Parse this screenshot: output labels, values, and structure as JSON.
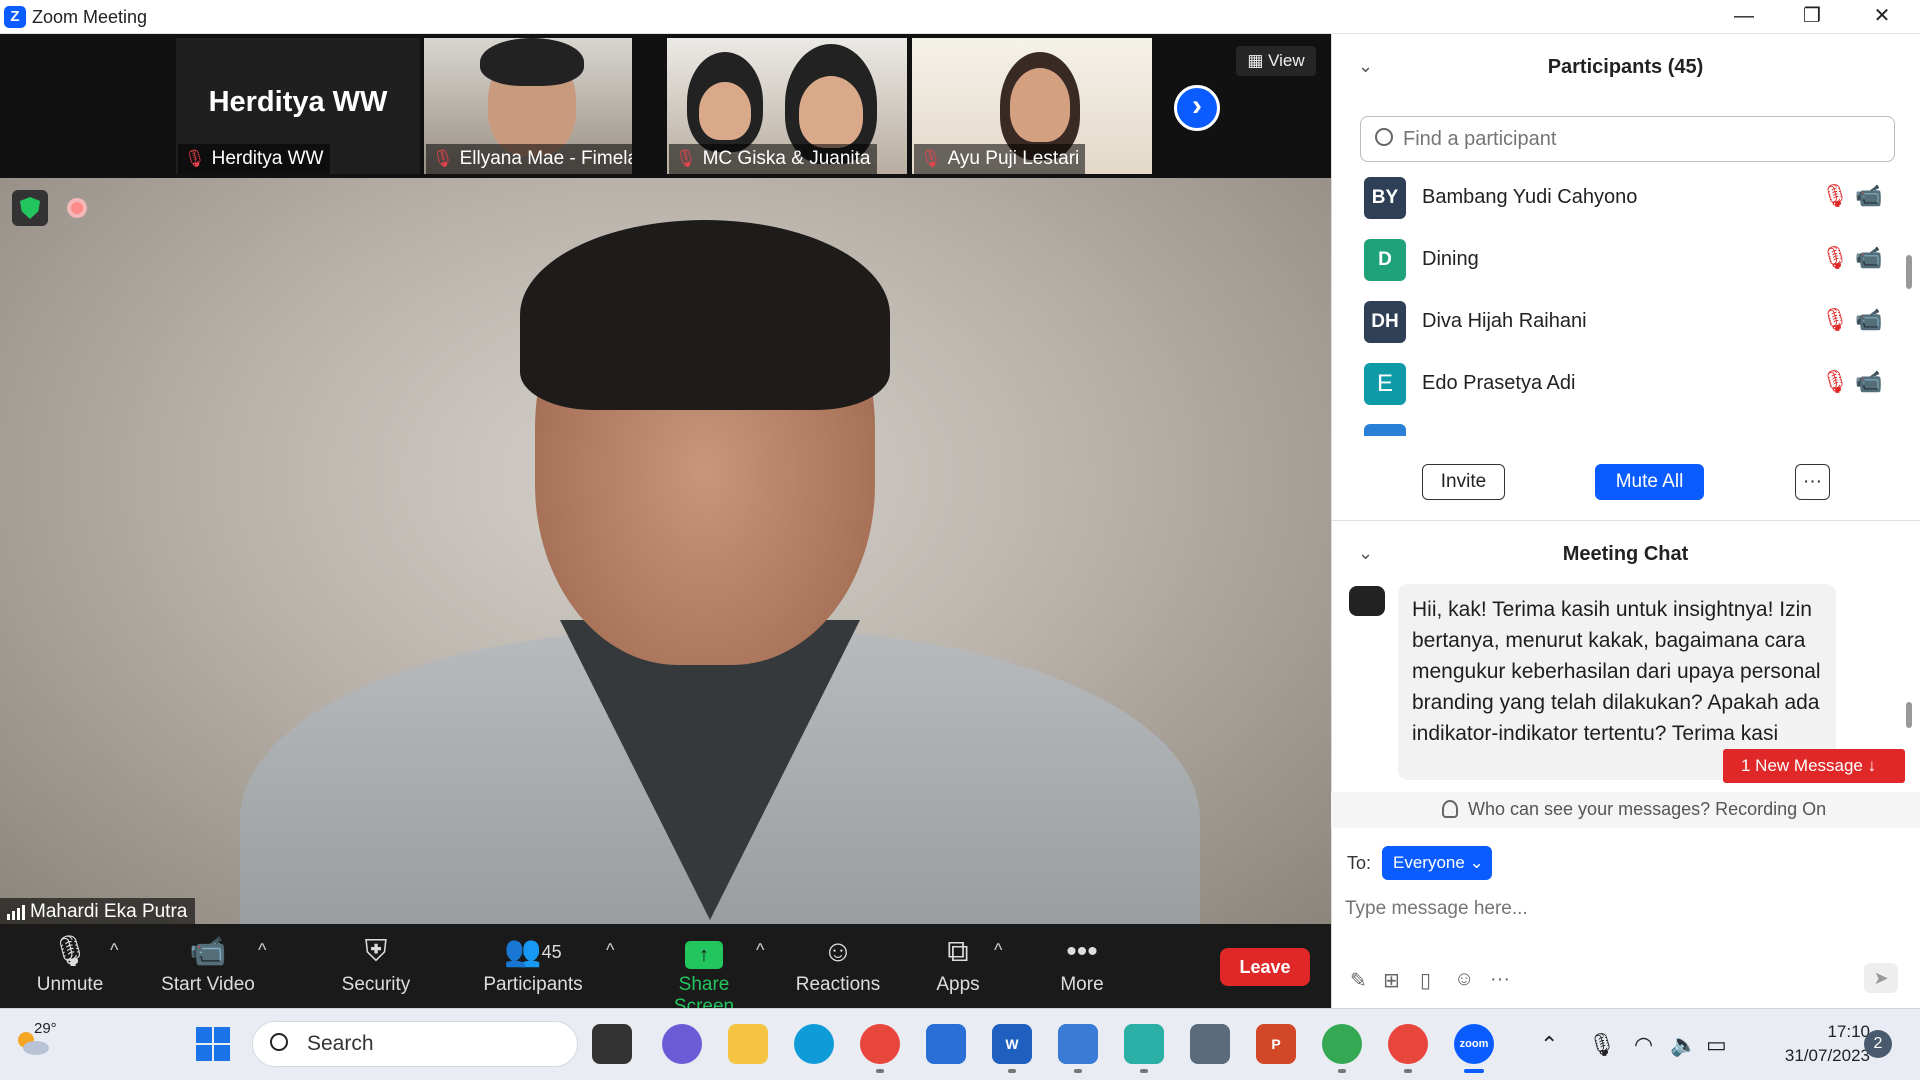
{
  "window": {
    "title": "Zoom Meeting",
    "minimize": "—",
    "restore": "❐",
    "close": "✕"
  },
  "thumbnails": [
    {
      "display_name": "Herditya WW",
      "label": "Herditya WW"
    },
    {
      "label": "Ellyana Mae - Fimela.c..."
    },
    {
      "label": "MC Giska & Juanita"
    },
    {
      "label": "Ayu Puji Lestari"
    }
  ],
  "view_button": "View",
  "next_page_glyph": "›",
  "active_speaker": {
    "name": "Mahardi Eka Putra"
  },
  "toolbar": {
    "unmute": "Unmute",
    "start_video": "Start Video",
    "security": "Security",
    "participants": "Participants",
    "participants_count": "45",
    "share_screen": "Share Screen",
    "reactions": "Reactions",
    "apps": "Apps",
    "more": "More",
    "leave": "Leave"
  },
  "participants_panel": {
    "title": "Participants (45)",
    "search_placeholder": "Find a participant",
    "list": [
      {
        "initials": "BY",
        "name": "Bambang Yudi Cahyono",
        "color": "#2f3f55"
      },
      {
        "initials": "D",
        "name": "Dining",
        "color": "#1fa27a"
      },
      {
        "initials": "DH",
        "name": "Diva Hijah Raihani",
        "color": "#2f3f55"
      },
      {
        "initials": "E",
        "name": "Edo Prasetya Adi",
        "color": "#0e9aa7"
      }
    ],
    "invite": "Invite",
    "mute_all": "Mute All",
    "more": "···"
  },
  "chat_panel": {
    "title": "Meeting Chat",
    "message": "Hii, kak! Terima kasih untuk insightnya! Izin bertanya, menurut kakak, bagaimana cara mengukur keberhasilan dari upaya personal branding yang telah dilakukan? Apakah ada indikator-indikator tertentu? Terima kasi",
    "new_message": "1 New Message ↓",
    "privacy_notice": "Who can see your messages? Recording On",
    "to_label": "To:",
    "recipient": "Everyone ⌄",
    "input_placeholder": "Type message here..."
  },
  "taskbar": {
    "temperature": "29°",
    "search": "Search",
    "time": "17:10",
    "date": "31/07/2023",
    "notifications": "2",
    "zoom_app_label": "zoom"
  },
  "colors": {
    "zoom_blue": "#0b5cff",
    "leave_red": "#e02828",
    "share_green": "#23c55e"
  }
}
